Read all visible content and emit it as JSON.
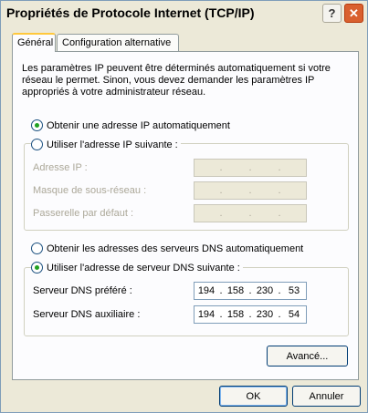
{
  "window": {
    "title": "Propriétés de Protocole Internet (TCP/IP)",
    "help_label": "?",
    "close_label": "✕"
  },
  "tabs": [
    {
      "label": "Général",
      "active": true
    },
    {
      "label": "Configuration alternative",
      "active": false
    }
  ],
  "intro_text": "Les paramètres IP peuvent être déterminés automatiquement si votre réseau le permet. Sinon, vous devez demander les paramètres IP appropriés à votre administrateur réseau.",
  "ip_mode": {
    "auto_label": "Obtenir une adresse IP automatiquement",
    "auto_selected": true,
    "manual_label": "Utiliser l'adresse IP suivante :",
    "manual_selected": false
  },
  "ip_fields": [
    {
      "label": "Adresse IP :",
      "value": [
        "",
        "",
        "",
        ""
      ]
    },
    {
      "label": "Masque de sous-réseau :",
      "value": [
        "",
        "",
        "",
        ""
      ]
    },
    {
      "label": "Passerelle par défaut :",
      "value": [
        "",
        "",
        "",
        ""
      ]
    }
  ],
  "dns_mode": {
    "auto_label": "Obtenir les adresses des serveurs DNS automatiquement",
    "auto_selected": false,
    "manual_label": "Utiliser l'adresse de serveur DNS suivante :",
    "manual_selected": true
  },
  "dns_fields": [
    {
      "label": "Serveur DNS préféré :",
      "value": [
        "194",
        "158",
        "230",
        "53"
      ]
    },
    {
      "label": "Serveur DNS auxiliaire :",
      "value": [
        "194",
        "158",
        "230",
        "54"
      ]
    }
  ],
  "buttons": {
    "advanced": "Avancé...",
    "ok": "OK",
    "cancel": "Annuler"
  },
  "colors": {
    "dialog_bg": "#ece9d8",
    "radio_dot": "#21a121",
    "close_button": "#d9602f",
    "active_tab_highlight": "#ffc83c"
  }
}
